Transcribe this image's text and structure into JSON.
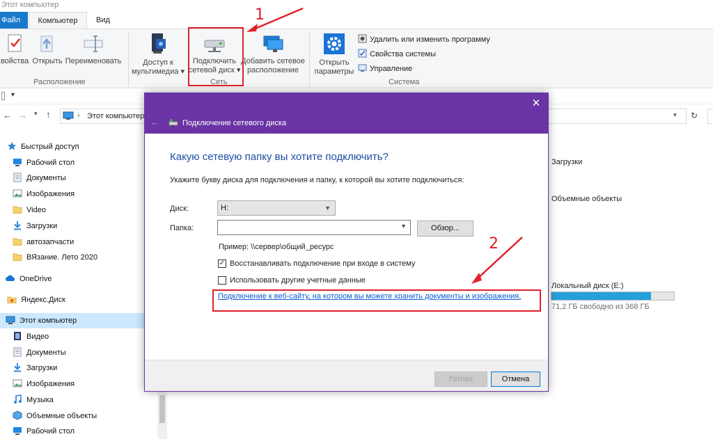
{
  "window": {
    "title": "Этот компьютер"
  },
  "tabs": {
    "file": "Файл",
    "computer": "Компьютер",
    "view": "Вид"
  },
  "ribbon": {
    "properties": "войства",
    "open": "Открыть",
    "rename": "Переименовать",
    "group_location": "Расположение",
    "media_access": {
      "line1": "Доступ к",
      "line2": "мультимедиа"
    },
    "map_drive": {
      "line1": "Подключить",
      "line2": "сетевой диск"
    },
    "add_network": {
      "line1": "Добавить сетевое",
      "line2": "расположение"
    },
    "group_network": "Сеть",
    "open_settings": {
      "line1": "Открыть",
      "line2": "параметры"
    },
    "uninstall": "Удалить или изменить программу",
    "system_props": "Свойства системы",
    "manage": "Управление",
    "group_system": "Система"
  },
  "address": {
    "path": "Этот компьютер"
  },
  "nav": {
    "items": [
      {
        "label": "Быстрый доступ",
        "icon": "star-icon"
      },
      {
        "label": "Рабочий стол",
        "icon": "desktop-icon"
      },
      {
        "label": "Документы",
        "icon": "documents-icon"
      },
      {
        "label": "Изображения",
        "icon": "pictures-icon"
      },
      {
        "label": "Video",
        "icon": "folder-icon"
      },
      {
        "label": "Загрузки",
        "icon": "downloads-icon"
      },
      {
        "label": "автозапчасти",
        "icon": "folder-icon"
      },
      {
        "label": "ВЯзание. Лето 2020",
        "icon": "folder-icon"
      },
      {
        "label": "OneDrive",
        "icon": "cloud-icon"
      },
      {
        "label": "Яндекс.Диск",
        "icon": "yandex-disk-icon"
      },
      {
        "label": "Этот компьютер",
        "icon": "computer-icon"
      },
      {
        "label": "Видео",
        "icon": "video-icon"
      },
      {
        "label": "Документы",
        "icon": "documents-icon"
      },
      {
        "label": "Загрузки",
        "icon": "downloads-icon"
      },
      {
        "label": "Изображения",
        "icon": "pictures-icon"
      },
      {
        "label": "Музыка",
        "icon": "music-icon"
      },
      {
        "label": "Объемные объекты",
        "icon": "3d-objects-icon"
      },
      {
        "label": "Рабочий стол",
        "icon": "desktop-icon"
      }
    ]
  },
  "main": {
    "downloads": "Загрузки",
    "objects3d": "Объемные объекты",
    "local_disk": "Локальный диск (E:)",
    "disk_free": "71,2 ГБ свободно из 368 ГБ",
    "disk_used_fraction": 0.81
  },
  "dialog": {
    "title": "Подключение сетевого диска",
    "heading": "Какую сетевую папку вы хотите подключить?",
    "instruction": "Укажите букву диска для подключения и папку, к которой вы хотите подключиться:",
    "drive_label": "Диск:",
    "drive_value": "H:",
    "folder_label": "Папка:",
    "folder_value": "",
    "browse": "Обзор...",
    "example": "Пример: \\\\сервер\\общий_ресурс",
    "reconnect": "Восстанавливать подключение при входе в систему",
    "reconnect_checked": true,
    "other_creds": "Использовать другие учетные данные",
    "other_creds_checked": false,
    "website_link": "Подключение к веб-сайту, на котором вы можете хранить документы и изображения",
    "link_period": ".",
    "finish": "Готово",
    "cancel": "Отмена"
  },
  "annotations": {
    "one": "1",
    "two": "2",
    "color": "#e0202c"
  },
  "colors": {
    "accent": "#1979ca",
    "dialog_header": "#6b34a6",
    "link": "#0b5bd3",
    "selection": "#cce8ff"
  }
}
